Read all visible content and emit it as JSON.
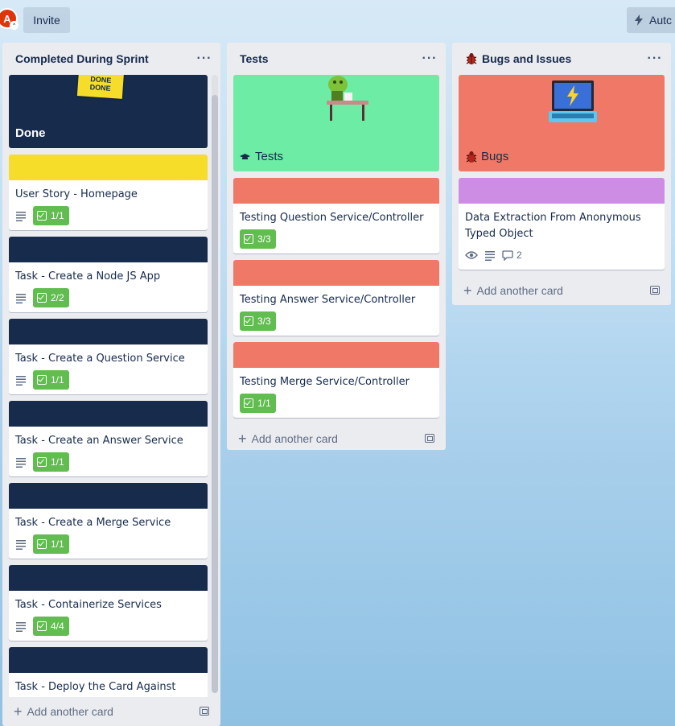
{
  "topbar": {
    "avatar_initial": "A",
    "invite_label": "Invite",
    "automation_label": "Autc"
  },
  "lists": {
    "completed": {
      "title": "Completed During Sprint",
      "menu": "···",
      "done_cover": {
        "title": "Done",
        "sticker": "DONE DONE",
        "color": "#172b4d"
      },
      "cards": [
        {
          "title": "User Story - Homepage",
          "cover_color": "#f5dd29",
          "checklist": "1/1"
        },
        {
          "title": "Task - Create a Node JS App",
          "cover_color": "#172b4d",
          "checklist": "2/2"
        },
        {
          "title": "Task - Create a Question Service",
          "cover_color": "#172b4d",
          "checklist": "1/1"
        },
        {
          "title": "Task - Create an Answer Service",
          "cover_color": "#172b4d",
          "checklist": "1/1"
        },
        {
          "title": "Task - Create a Merge Service",
          "cover_color": "#172b4d",
          "checklist": "1/1"
        },
        {
          "title": "Task - Containerize Services",
          "cover_color": "#172b4d",
          "checklist": "4/4"
        },
        {
          "title": "Task - Deploy the Card Against Application",
          "cover_color": "#172b4d",
          "checklist": ""
        }
      ],
      "add_card": "Add another card"
    },
    "tests": {
      "title": "Tests",
      "menu": "···",
      "cover": {
        "title": "Tests",
        "color": "#6deca6"
      },
      "cards": [
        {
          "title": "Testing Question Service/Controller",
          "cover_color": "#f07866",
          "checklist": "3/3"
        },
        {
          "title": "Testing Answer Service/Controller",
          "cover_color": "#f07866",
          "checklist": "3/3"
        },
        {
          "title": "Testing Merge Service/Controller",
          "cover_color": "#f07866",
          "checklist": "1/1"
        }
      ],
      "add_card": "Add another card"
    },
    "bugs": {
      "title": "Bugs and Issues",
      "menu": "···",
      "cover": {
        "title": "Bugs",
        "color": "#f07866"
      },
      "cards": [
        {
          "title": "Data Extraction From Anonymous Typed Object",
          "cover_color": "#cd8de5",
          "comments": "2"
        }
      ],
      "add_card": "Add another card"
    }
  },
  "icons": {
    "description": "description-icon",
    "checklist": "checklist-icon",
    "watch": "eye-icon",
    "comment": "comment-icon",
    "bug": "bug-icon",
    "bolt": "lightning-icon"
  }
}
